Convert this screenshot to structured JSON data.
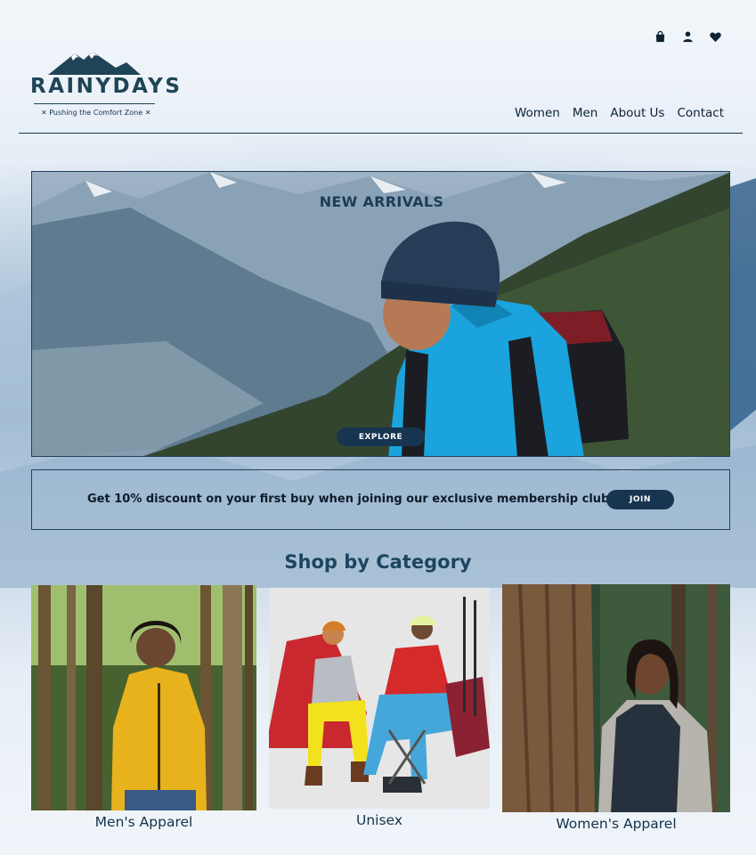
{
  "brand": {
    "name": "RAINYDAYS",
    "tagline": "✕ Pushing the Comfort Zone ✕"
  },
  "header": {
    "icons": [
      "shopping-bag-icon",
      "user-icon",
      "heart-icon"
    ],
    "nav": [
      "Women",
      "Men",
      "About Us",
      "Contact"
    ]
  },
  "hero": {
    "title": "NEW ARRIVALS",
    "button": "EXPLORE"
  },
  "promo": {
    "text": "Get 10% discount on your first buy when joining our exclusive membership club",
    "button": "JOIN"
  },
  "categories": {
    "title": "Shop by Category",
    "items": [
      {
        "label": "Men's Apparel"
      },
      {
        "label": "Unisex"
      },
      {
        "label": "Women's Apparel"
      }
    ]
  },
  "colors": {
    "primary": "#173550",
    "text": "#12324a",
    "jacket_blue": "#1aa3dc",
    "jacket_yellow": "#e8b21c",
    "jacket_red": "#d42a2a"
  }
}
